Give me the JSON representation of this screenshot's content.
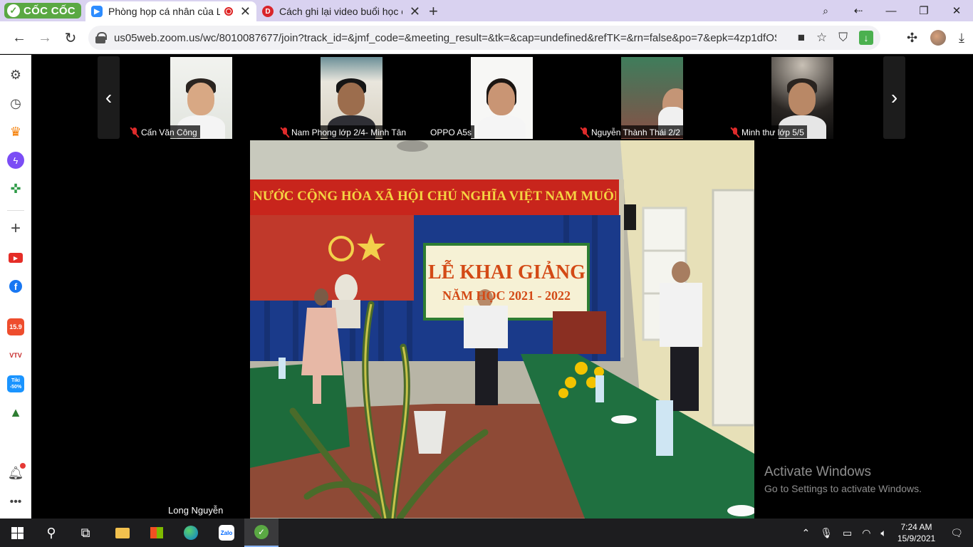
{
  "browser": {
    "brand": "CỐC CỐC",
    "tabs": [
      {
        "title": "Phòng họp cá nhân của L",
        "active": true
      },
      {
        "title": "Cách ghi lại video buổi học o",
        "active": false
      }
    ],
    "new_tab_icon": "plus-icon",
    "window_controls": [
      "minimize-icon",
      "restore-icon",
      "close-icon"
    ],
    "url": "us05web.zoom.us/wc/8010087677/join?track_id=&jmf_code=&meeting_result=&tk=&cap=undefined&refTK=&rn=false&po=7&epk=4zp1dfOSU6..."
  },
  "sidebar": {
    "items": [
      "settings-icon",
      "history-icon",
      "crown-icon",
      "messenger-icon",
      "gamepad-icon",
      "add-icon",
      "youtube-icon",
      "facebook-icon",
      "shopee-icon",
      "vtv-go-icon",
      "tiki-icon",
      "hat-icon",
      "bell-icon",
      "more-icon"
    ],
    "shopee_label": "15.9",
    "vtv_label": "VTV",
    "tiki_label": "Tiki -50%"
  },
  "meeting": {
    "participants": [
      {
        "name": "Cấn Văn Công",
        "muted": true
      },
      {
        "name": "Nam Phong lớp 2/4- Minh Tân",
        "muted": true
      },
      {
        "name": "OPPO A5s",
        "muted": false
      },
      {
        "name": "Nguyễn Thành Thái 2/2",
        "muted": true
      },
      {
        "name": "Minh thư lớp 5/5",
        "muted": true
      }
    ],
    "active_speaker": "Long Nguyễn",
    "stage": {
      "banner": "NƯỚC CỘNG HÒA XÃ HỘI CHỦ NGHĨA VIỆT NAM MUÔN NĂM",
      "board_title": "LỄ KHAI GIẢNG",
      "board_subtitle": "NĂM HỌC 2021 - 2022"
    }
  },
  "watermark": {
    "line1": "Activate Windows",
    "line2": "Go to Settings to activate Windows."
  },
  "taskbar": {
    "time": "7:24 AM",
    "date": "15/9/2021",
    "zalo_label": "Zalo"
  },
  "colors": {
    "tabstrip": "#d9d2f0",
    "brand_green": "#5aa843",
    "banner_red": "#c8251c",
    "banner_text": "#f5d442",
    "curtain_blue": "#1a3a8a"
  }
}
